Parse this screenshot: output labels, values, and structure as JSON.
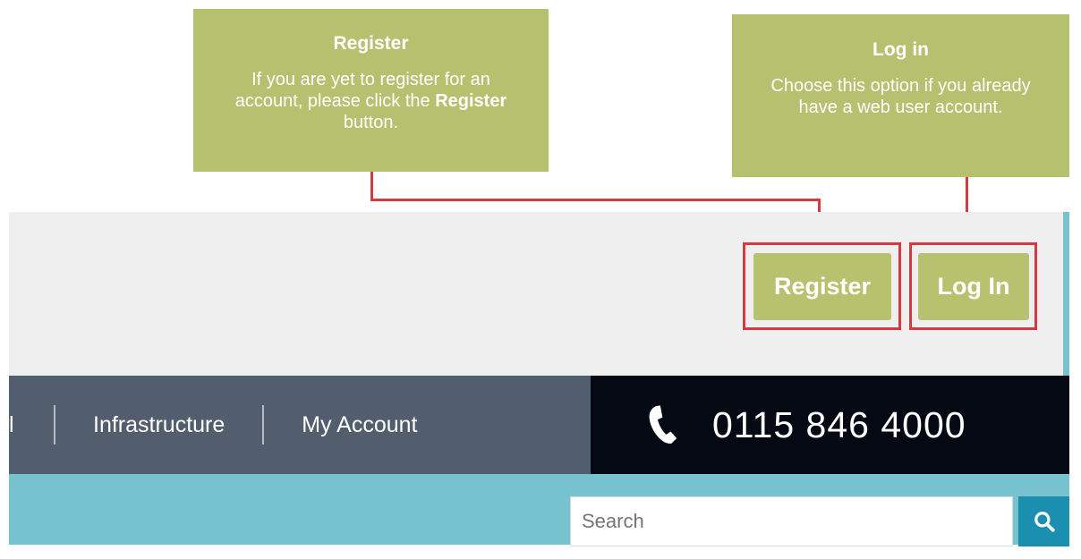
{
  "callouts": {
    "register": {
      "title": "Register",
      "text_before": "If you are yet to register for an account, please click the",
      "bold": "Register",
      "text_after": "button."
    },
    "login": {
      "title": "Log in",
      "text": "Choose this option if you already have a web user account."
    }
  },
  "header": {
    "register_label": "Register",
    "login_label": "Log In"
  },
  "nav": {
    "partial_item": "l",
    "items": [
      "Infrastructure",
      "My Account"
    ]
  },
  "phone": {
    "number": "0115 846 4000",
    "icon": "phone-icon"
  },
  "search": {
    "placeholder": "Search",
    "icon": "search-icon"
  },
  "colors": {
    "accent_green": "#b7c26e",
    "highlight_red": "#d63a40",
    "teal": "#76c2cf",
    "nav_bg": "#525e6d",
    "phone_bg": "#050914",
    "search_button": "#1b8fb0"
  }
}
